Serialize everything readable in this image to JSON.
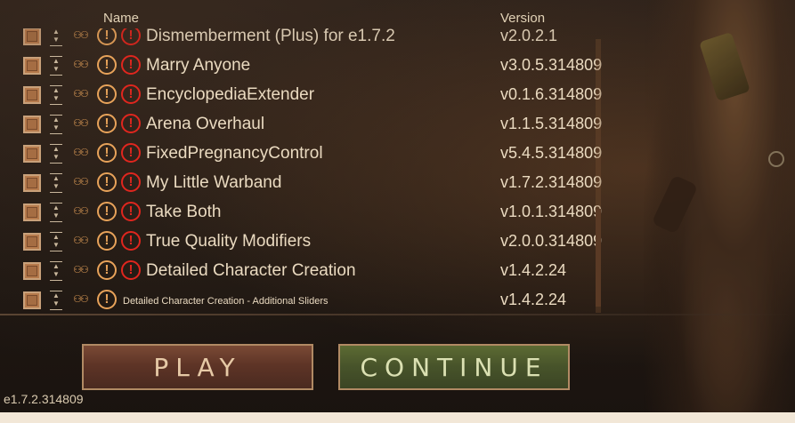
{
  "header": {
    "name_label": "Name",
    "version_label": "Version"
  },
  "mods": [
    {
      "name": "Dismemberment (Plus) for e1.7.2",
      "version": "v2.0.2.1",
      "has_error": true,
      "small": false,
      "partial": true
    },
    {
      "name": "Marry Anyone",
      "version": "v3.0.5.314809",
      "has_error": true,
      "small": false
    },
    {
      "name": "EncyclopediaExtender",
      "version": "v0.1.6.314809",
      "has_error": true,
      "small": false
    },
    {
      "name": "Arena Overhaul",
      "version": "v1.1.5.314809",
      "has_error": true,
      "small": false
    },
    {
      "name": "FixedPregnancyControl",
      "version": "v5.4.5.314809",
      "has_error": true,
      "small": false
    },
    {
      "name": "My Little Warband",
      "version": "v1.7.2.314809",
      "has_error": true,
      "small": false
    },
    {
      "name": "Take Both",
      "version": "v1.0.1.314809",
      "has_error": true,
      "small": false
    },
    {
      "name": "True Quality Modifiers",
      "version": "v2.0.0.314809",
      "has_error": true,
      "small": false
    },
    {
      "name": "Detailed Character Creation",
      "version": "v1.4.2.24",
      "has_error": true,
      "small": false
    },
    {
      "name": "Detailed Character Creation - Additional Sliders",
      "version": "v1.4.2.24",
      "has_error": false,
      "small": true
    }
  ],
  "buttons": {
    "play_label": "PLAY",
    "continue_label": "CONTINUE"
  },
  "game_version": "e1.7.2.314809",
  "colors": {
    "warning": "#e8a35a",
    "error": "#e0261e",
    "play_bg": "#5e3426",
    "continue_bg": "#47532a"
  },
  "icons": {
    "checkbox": "checkbox-icon",
    "drag": "drag-handle-icon",
    "dependency": "people-icon",
    "warning": "warning-icon",
    "error": "error-icon"
  }
}
